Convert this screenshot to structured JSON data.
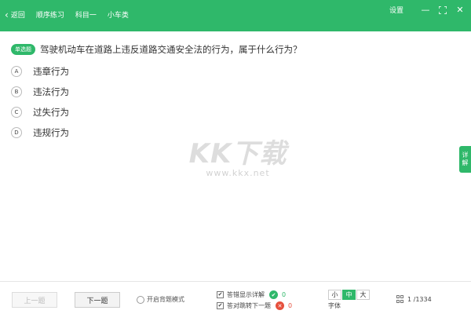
{
  "header": {
    "back_label": "返回",
    "nav": [
      "顺序练习",
      "科目一",
      "小车类"
    ],
    "settings_label": "设置",
    "window_controls": [
      "minimize-icon",
      "fullscreen-icon",
      "close-icon"
    ],
    "bg_color": "#2fb86a"
  },
  "question": {
    "type_badge": "单选题",
    "text": "驾驶机动车在道路上违反道路交通安全法的行为，属于什么行为？",
    "options": [
      {
        "letter": "A",
        "text": "违章行为"
      },
      {
        "letter": "B",
        "text": "违法行为"
      },
      {
        "letter": "C",
        "text": "过失行为"
      },
      {
        "letter": "D",
        "text": "违规行为"
      }
    ]
  },
  "watermark": {
    "title": "KK下载",
    "url": "www.kkx.net"
  },
  "side_tab": {
    "label_top": "详",
    "label_bottom": "解"
  },
  "footer": {
    "prev_label": "上一题",
    "next_label": "下一题",
    "recite_label": "开启背题模式",
    "option1_label": "答错显示详解",
    "option2_label": "答对跳转下一题",
    "correct_count": "0",
    "wrong_count": "0",
    "font_sizes": [
      "小",
      "中",
      "大"
    ],
    "font_active": "中",
    "font_label": "字体",
    "progress": "1 /1334"
  }
}
